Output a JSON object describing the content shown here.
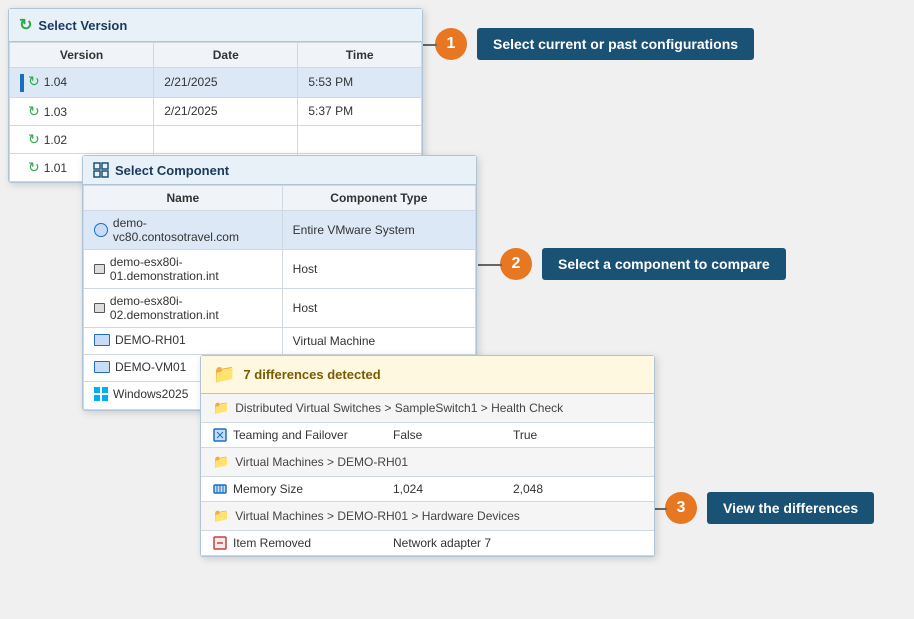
{
  "step1": {
    "badge": "1",
    "label": "Select current or past configurations"
  },
  "step2": {
    "badge": "2",
    "label": "Select a component to compare"
  },
  "step3": {
    "badge": "3",
    "label": "View the differences"
  },
  "version_panel": {
    "title": "Select Version",
    "columns": [
      "Version",
      "Date",
      "Time"
    ],
    "rows": [
      {
        "version": "1.04",
        "date": "2/21/2025",
        "time": "5:53 PM",
        "selected": true
      },
      {
        "version": "1.03",
        "date": "2/21/2025",
        "time": "5:37 PM",
        "selected": false
      },
      {
        "version": "1.02",
        "date": "",
        "time": "",
        "selected": false
      },
      {
        "version": "1.01",
        "date": "",
        "time": "",
        "selected": false
      }
    ]
  },
  "component_panel": {
    "title": "Select Component",
    "columns": [
      "Name",
      "Component Type"
    ],
    "rows": [
      {
        "name": "demo-vc80.contosotravel.com",
        "type": "Entire VMware System",
        "selected": true,
        "icon": "globe"
      },
      {
        "name": "demo-esx80i-01.demonstration.int",
        "type": "Host",
        "selected": false,
        "icon": "host"
      },
      {
        "name": "demo-esx80i-02.demonstration.int",
        "type": "Host",
        "selected": false,
        "icon": "host"
      },
      {
        "name": "DEMO-RH01",
        "type": "Virtual Machine",
        "selected": false,
        "icon": "monitor"
      },
      {
        "name": "DEMO-VM01",
        "type": "",
        "selected": false,
        "icon": "monitor"
      },
      {
        "name": "Windows2025",
        "type": "",
        "selected": false,
        "icon": "windows"
      }
    ]
  },
  "diff_panel": {
    "summary": "7 differences detected",
    "sections": [
      {
        "type": "folder",
        "path": "Distributed Virtual Switches > SampleSwitch1 > Health Check",
        "rows": [
          {
            "name": "Teaming and Failover",
            "old": "False",
            "new": "True",
            "icon": "network"
          }
        ]
      },
      {
        "type": "folder",
        "path": "Virtual Machines > DEMO-RH01",
        "rows": [
          {
            "name": "Memory Size",
            "old": "1,024",
            "new": "2,048",
            "icon": "memory"
          }
        ]
      },
      {
        "type": "folder",
        "path": "Virtual Machines > DEMO-RH01 > Hardware Devices",
        "rows": [
          {
            "name": "Item Removed",
            "old": "Network adapter 7",
            "new": "",
            "icon": "removed"
          }
        ]
      }
    ]
  }
}
